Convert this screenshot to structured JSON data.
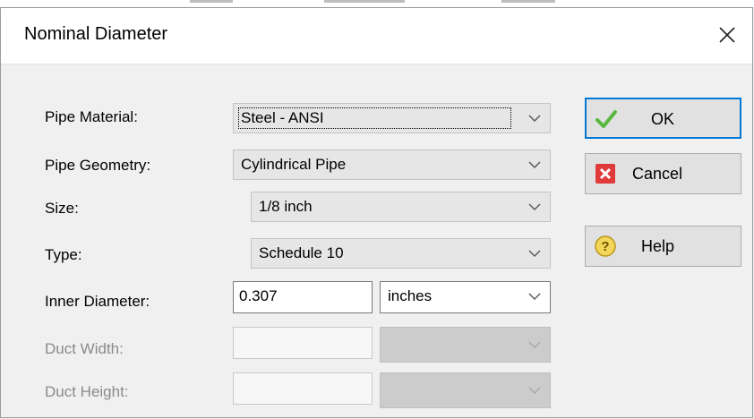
{
  "dialog": {
    "title": "Nominal Diameter",
    "close_icon": "close-icon"
  },
  "fields": {
    "pipe_material": {
      "label": "Pipe Material:",
      "value": "Steel - ANSI"
    },
    "pipe_geometry": {
      "label": "Pipe Geometry:",
      "value": "Cylindrical Pipe"
    },
    "size": {
      "label": "Size:",
      "value": "1/8 inch"
    },
    "type": {
      "label": "Type:",
      "value": "Schedule 10"
    },
    "inner_diameter": {
      "label": "Inner Diameter:",
      "value": "0.307",
      "unit": "inches"
    },
    "duct_width": {
      "label": "Duct Width:",
      "value": "",
      "unit": "",
      "enabled": false
    },
    "duct_height": {
      "label": "Duct Height:",
      "value": "",
      "unit": "",
      "enabled": false
    }
  },
  "buttons": {
    "ok": {
      "label": "OK",
      "icon": "checkmark-icon",
      "color": "#58b73d"
    },
    "cancel": {
      "label": "Cancel",
      "icon": "cancel-x-icon",
      "color": "#e03a3a"
    },
    "help": {
      "label": "Help",
      "icon": "help-question-icon",
      "color": "#d9b32a"
    }
  },
  "colors": {
    "focus_border": "#0078d7",
    "disabled_text": "#8a8a8a"
  }
}
